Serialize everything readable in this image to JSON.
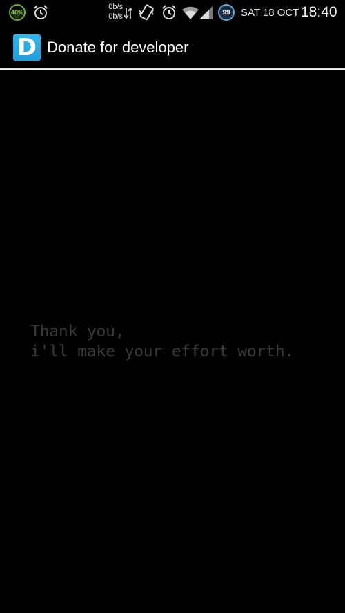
{
  "status_bar": {
    "battery_percent": "48%",
    "net_speed_up": "0b/s",
    "net_speed_down": "0b/s",
    "notification_count": "99",
    "date": "SAT 18 OCT",
    "time": "18:40",
    "icons": [
      "battery-icon",
      "alarm-icon",
      "data-transfer-icon",
      "vibrate-icon",
      "alarm-icon",
      "wifi-icon",
      "signal-icon",
      "notification-badge"
    ]
  },
  "action_bar": {
    "app_icon_letter": "D",
    "title": "Donate for developer"
  },
  "content": {
    "line1": "Thank you,",
    "line2": "i'll make your effort worth."
  },
  "colors": {
    "background": "#000000",
    "accent": "#1e9fdc",
    "divider": "#e8e8e8",
    "message_text": "#3a3a3a"
  }
}
